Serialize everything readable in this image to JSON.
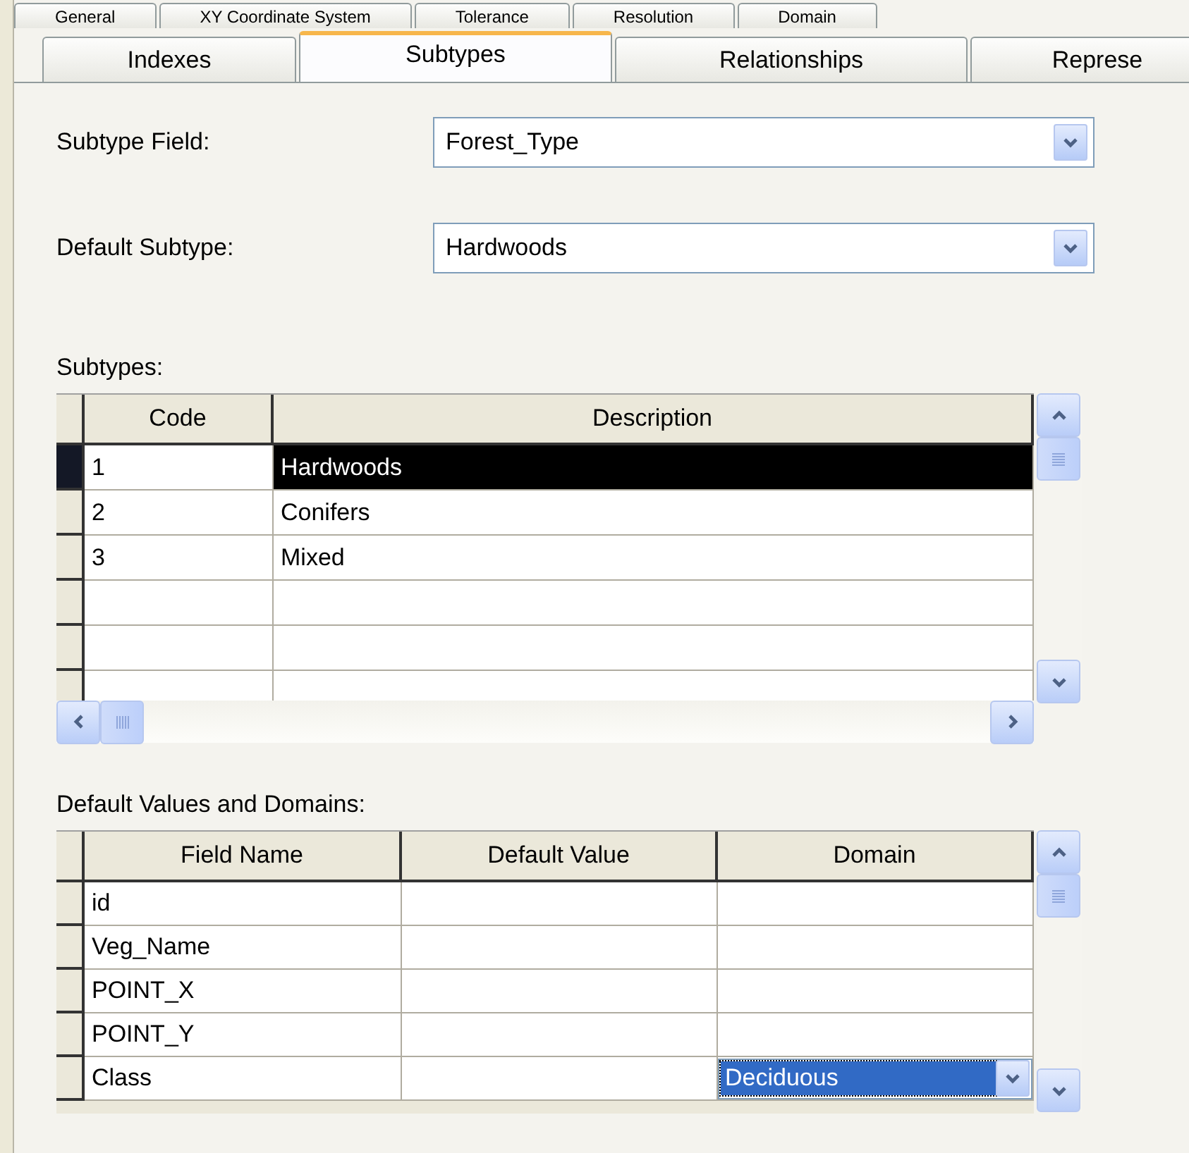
{
  "tab_rows": [
    [
      {
        "label": "General",
        "selected": false
      },
      {
        "label": "XY Coordinate System",
        "selected": false
      },
      {
        "label": "Tolerance",
        "selected": false
      },
      {
        "label": "Resolution",
        "selected": false
      },
      {
        "label": "Domain",
        "selected": false
      }
    ],
    [
      {
        "label": "Indexes",
        "selected": false
      },
      {
        "label": "Subtypes",
        "selected": true
      },
      {
        "label": "Relationships",
        "selected": false
      },
      {
        "label": "Represe",
        "selected": false
      }
    ]
  ],
  "subtype_field": {
    "label": "Subtype Field:",
    "value": "Forest_Type"
  },
  "default_subtype": {
    "label": "Default Subtype:",
    "value": "Hardwoods"
  },
  "subtypes": {
    "label": "Subtypes:",
    "columns": [
      "Code",
      "Description"
    ],
    "rows": [
      {
        "code": "1",
        "description": "Hardwoods",
        "selected": true
      },
      {
        "code": "2",
        "description": "Conifers",
        "selected": false
      },
      {
        "code": "3",
        "description": "Mixed",
        "selected": false
      }
    ]
  },
  "defaults": {
    "label": "Default Values and Domains:",
    "columns": [
      "Field Name",
      "Default Value",
      "Domain"
    ],
    "rows": [
      {
        "field_name": "id"
      },
      {
        "field_name": "Veg_Name"
      },
      {
        "field_name": "POINT_X"
      },
      {
        "field_name": "POINT_Y"
      },
      {
        "field_name": "Class",
        "domain": "Deciduous"
      }
    ]
  }
}
